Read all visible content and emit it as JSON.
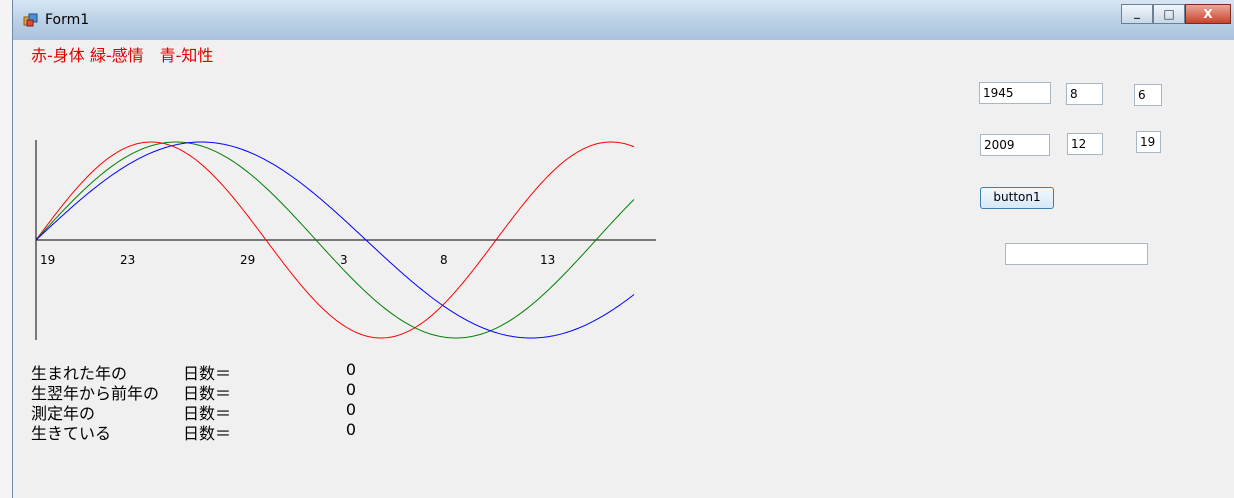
{
  "window": {
    "title": "Form1",
    "buttons": {
      "minimize": "_",
      "maximize": "□",
      "close": "X"
    }
  },
  "legend_text": "赤-身体 緑-感情　青-知性",
  "inputs": {
    "birth_year": "1945",
    "birth_month": "8",
    "birth_day": "6",
    "measure_year": "2009",
    "measure_month": "12",
    "measure_day": "19",
    "result": ""
  },
  "button1_label": "button1",
  "info_rows": [
    {
      "label": "生まれた年の",
      "label2": "日数＝",
      "value": "0"
    },
    {
      "label": "生翌年から前年の",
      "label2": "日数＝",
      "value": "0"
    },
    {
      "label": "測定年の",
      "label2": "日数＝",
      "value": "0"
    },
    {
      "label": "生きている",
      "label2": "日数＝",
      "value": "0"
    }
  ],
  "chart_data": {
    "type": "line",
    "x_tick_labels": [
      "19",
      "23",
      "29",
      "3",
      "8",
      "13"
    ],
    "x_tick_days": [
      0,
      4,
      10,
      15,
      20,
      25
    ],
    "x_range_days": [
      0,
      30
    ],
    "y_range": [
      -1,
      1
    ],
    "series": [
      {
        "period_days": 23,
        "color": "#ff0000"
      },
      {
        "period_days": 28,
        "color": "#008000"
      },
      {
        "period_days": 33,
        "color": "#0000ff"
      }
    ]
  }
}
